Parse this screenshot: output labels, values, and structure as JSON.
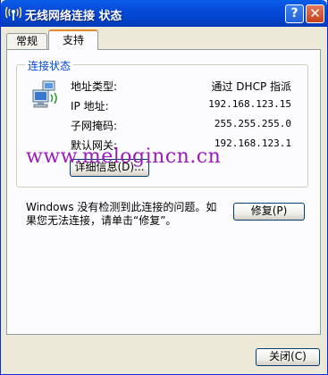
{
  "window": {
    "title": "无线网络连接 状态"
  },
  "titlebar": {
    "help_glyph": "?",
    "close_glyph": "✕"
  },
  "tabs": [
    {
      "label": "常规"
    },
    {
      "label": "支持"
    }
  ],
  "connection_status": {
    "legend": "连接状态",
    "rows": [
      {
        "label": "地址类型:",
        "value": "通过 DHCP 指派"
      },
      {
        "label": "IP 地址:",
        "value": "192.168.123.15"
      },
      {
        "label": "子网掩码:",
        "value": "255.255.255.0"
      },
      {
        "label": "默认网关:",
        "value": "192.168.123.1"
      }
    ],
    "details_button": "详细信息(D)..."
  },
  "repair": {
    "message": "Windows 没有检测到此连接的问题。如果您无法连接，请单击“修复”。",
    "button": "修复(P)"
  },
  "footer": {
    "close_button": "关闭(C)"
  },
  "watermark": "www.melogincn.cn",
  "colors": {
    "titlebar": "#0054e3",
    "legend": "#0046d5",
    "watermark": "#9b1bb7"
  }
}
